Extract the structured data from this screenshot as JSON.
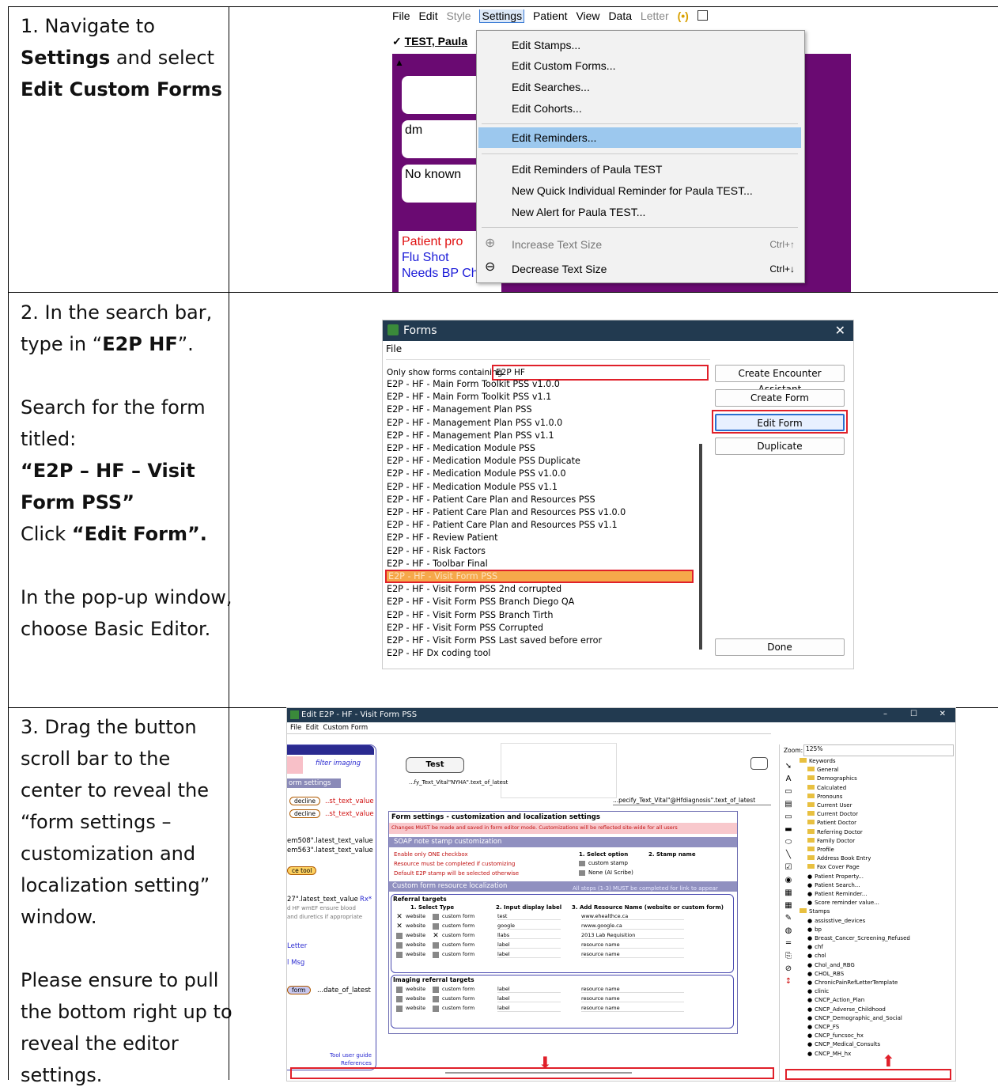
{
  "steps": [
    {
      "text_parts": [
        {
          "t": "1. Navigate to ",
          "b": false
        },
        {
          "t": "Settings",
          "b": true
        },
        {
          "t": " and select ",
          "b": false
        },
        {
          "t": "Edit Custom Forms",
          "b": true
        }
      ]
    },
    {
      "p1_parts": [
        {
          "t": "2. In the search bar, type in “",
          "b": false
        },
        {
          "t": "E2P HF",
          "b": true
        },
        {
          "t": "”.",
          "b": false
        }
      ],
      "p2": "Search for the form titled:",
      "p3_bold": "“E2P – HF – Visit Form PSS”",
      "p4_parts": [
        {
          "t": "Click ",
          "b": false
        },
        {
          "t": "“Edit Form”.",
          "b": true
        }
      ],
      "p5": "In the pop-up window, choose Basic Editor."
    },
    {
      "p1": "3. Drag the button scroll bar to the center to reveal the “form settings – customization and localization setting” window.",
      "p2": "Please ensure to pull the bottom right up to reveal the editor settings."
    }
  ],
  "shot1": {
    "menu": [
      "File",
      "Edit",
      "Style",
      "Settings",
      "Patient",
      "View",
      "Data",
      "Letter"
    ],
    "patient_name": "TEST, Paula",
    "box_dm": "dm",
    "box_allergy": "No known",
    "reminder_red": "Patient pro",
    "reminder_flu": "Flu Shot",
    "reminder_bp": "Needs BP Check",
    "dropdown": [
      "Edit Stamps...",
      "Edit Custom Forms...",
      "Edit Searches...",
      "Edit Cohorts...",
      "Edit Reminders...",
      "Edit Reminders of Paula TEST",
      "New Quick Individual Reminder for Paula TEST...",
      "New Alert for Paula TEST...",
      "Increase Text Size",
      "Decrease Text Size"
    ],
    "shortcut_increase": "Ctrl+↑",
    "shortcut_decrease": "Ctrl+↓"
  },
  "shot2": {
    "title": "Forms",
    "menu_file": "File",
    "filter_label": "Only show forms containing",
    "filter_value": "E2P HF",
    "forms": [
      "E2P - HF - Main Form Toolkit PSS v1.0.0",
      "E2P - HF - Main Form Toolkit PSS v1.1",
      "E2P - HF - Management Plan PSS",
      "E2P - HF - Management Plan PSS v1.0.0",
      "E2P - HF - Management Plan PSS v1.1",
      "E2P - HF - Medication Module PSS",
      "E2P - HF - Medication Module PSS Duplicate",
      "E2P - HF - Medication Module PSS v1.0.0",
      "E2P - HF - Medication Module PSS v1.1",
      "E2P - HF - Patient Care Plan and Resources PSS",
      "E2P - HF - Patient Care Plan and Resources PSS v1.0.0",
      "E2P - HF - Patient Care Plan and Resources PSS v1.1",
      "E2P - HF - Review Patient",
      "E2P - HF - Risk Factors",
      "E2P - HF - Toolbar Final",
      "E2P - HF - Visit Form PSS",
      "E2P - HF - Visit Form PSS 2nd corrupted",
      "E2P - HF - Visit Form PSS Branch Diego QA",
      "E2P - HF - Visit Form PSS Branch Tirth",
      "E2P - HF - Visit Form PSS Corrupted",
      "E2P - HF - Visit Form PSS Last saved before error",
      "E2P - HF Dx coding tool"
    ],
    "buttons": [
      "Create Encounter Assistant",
      "Create Form",
      "Edit Form",
      "Duplicate",
      "Done"
    ]
  },
  "shot3": {
    "title": "Edit E2P - HF - Visit Form PSS",
    "menu": [
      "File",
      "Edit",
      "Custom Form"
    ],
    "left_filter": "filter imaging",
    "left_form_settings": "orm settings",
    "left_decline": "decline",
    "left_text1": "..st_text_value",
    "left_text2": "..st_text_value",
    "left_em508": "em508\".latest_text_value",
    "left_em563": "em563\".latest_text_value",
    "left_tool": "ce tool",
    "left_27": "27\".latest_text_value",
    "left_rx": "Rx*",
    "left_hf1": "d HF wmEF ensure blood",
    "left_hf2": "and diuretics if appropriate",
    "left_letter": "Letter",
    "left_msg": "l Msg",
    "left_form": "form",
    "left_date": "...date_of_latest",
    "left_guide": "Tool user guide",
    "left_refs": "References",
    "test_btn": "Test",
    "nyha": "...fy_Text_Vital\"NYHA\".text_of_latest",
    "hfdiag": "...pecify_Text_Vital\"@Hfdiagnosis\".text_of_latest",
    "fs_title": "Form settings - customization and localization settings",
    "fs_warning": "Changes MUST be made and saved in form editor mode. Customizations will be reflected site-wide for all users",
    "soap_header": "SOAP note stamp customization",
    "soap_rows": [
      "Enable only ONE checkbox",
      "Resource must be completed if customizing",
      "Default E2P stamp will be selected otherwise"
    ],
    "select_option": "1. Select option",
    "stamp_name": "2. Stamp name",
    "opt_custom": "custom stamp",
    "opt_none": "None (AI Scribe)",
    "loc_header": "Custom form resource localization",
    "loc_note": "All steps (1-3) MUST be completed for link to appear",
    "ref_targets": "Referral targets",
    "col1": "1. Select Type",
    "col2": "2. Input display label",
    "col3": "3. Add Resource Name (website or custom form)",
    "ref_rows": [
      {
        "label": "test",
        "res": "www.ehealthce.ca"
      },
      {
        "label": "google",
        "res": "rwww.google.ca"
      },
      {
        "label": "llabs",
        "res": "2013 Lab Requisition"
      },
      {
        "label": "label",
        "res": "resource name"
      },
      {
        "label": "label",
        "res": "resource name"
      }
    ],
    "img_targets": "Imaging referral targets",
    "img_rows": [
      {
        "label": "label",
        "res": "resource name"
      },
      {
        "label": "label",
        "res": "resource name"
      },
      {
        "label": "label",
        "res": "resource name"
      }
    ],
    "type_website": "website",
    "type_custom": "custom form",
    "zoom_label": "Zoom:",
    "zoom_value": "125%",
    "tree": [
      "Keywords",
      "General",
      "Demographics",
      "Calculated",
      "Pronouns",
      "Current User",
      "Current Doctor",
      "Patient Doctor",
      "Referring Doctor",
      "Family Doctor",
      "Profile",
      "Address Book Entry",
      "Fax Cover Page",
      "Patient Property...",
      "Patient Search...",
      "Patient Reminder...",
      "Score reminder value...",
      "Stamps",
      "assisstive_devices",
      "bp",
      "Breast_Cancer_Screening_Refused",
      "chf",
      "chol",
      "Chol_and_RBG",
      "CHOL_RBS",
      "ChronicPainRefLetterTemplate",
      "clinic",
      "CNCP_Action_Plan",
      "CNCP_Adverse_Childhood",
      "CNCP_Demographic_and_Social",
      "CNCP_FS",
      "CNCP_funcsoc_hx",
      "CNCP_Medical_Consults",
      "CNCP_MH_hx"
    ]
  }
}
